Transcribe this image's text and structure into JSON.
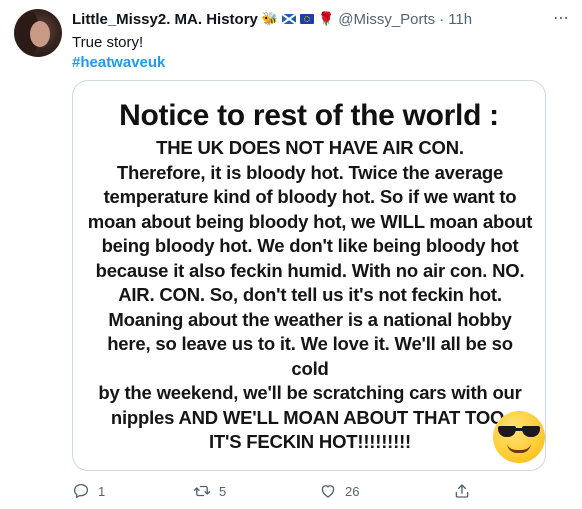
{
  "author": {
    "display_name": "Little_Missy2. MA. History",
    "emojis": [
      "bee",
      "scotland-flag",
      "eu-flag",
      "rose"
    ],
    "handle": "@Missy_Ports",
    "separator": "·",
    "time": "11h"
  },
  "tweet": {
    "text": "True story!",
    "hashtag": "#heatwaveuk"
  },
  "image": {
    "title": "Notice to rest of the world :",
    "body_lines": [
      "THE UK DOES NOT HAVE AIR CON.",
      "Therefore, it is bloody hot. Twice the average",
      "temperature kind of bloody hot. So if we want to",
      "moan about being bloody hot, we WILL moan about",
      "being bloody hot. We don't like being bloody hot",
      "because it also feckin humid. With no air con. NO.",
      "AIR. CON. So, don't tell us it's not feckin hot.",
      "Moaning about the weather is a national hobby",
      "here, so leave us to it. We love it. We'll all be so cold",
      "by the weekend, we'll be scratching cars with our",
      "nipples AND WE'LL MOAN ABOUT THAT TOO.",
      "IT'S FECKIN HOT!!!!!!!!!"
    ],
    "emoji": "sunglasses-face"
  },
  "actions": {
    "reply_count": "1",
    "retweet_count": "5",
    "like_count": "26",
    "share_count": ""
  },
  "colors": {
    "link": "#1d9bf0",
    "muted": "#536471",
    "text": "#0f1419",
    "border": "#cfd9de"
  },
  "menu": {
    "more_icon": "⋯"
  }
}
